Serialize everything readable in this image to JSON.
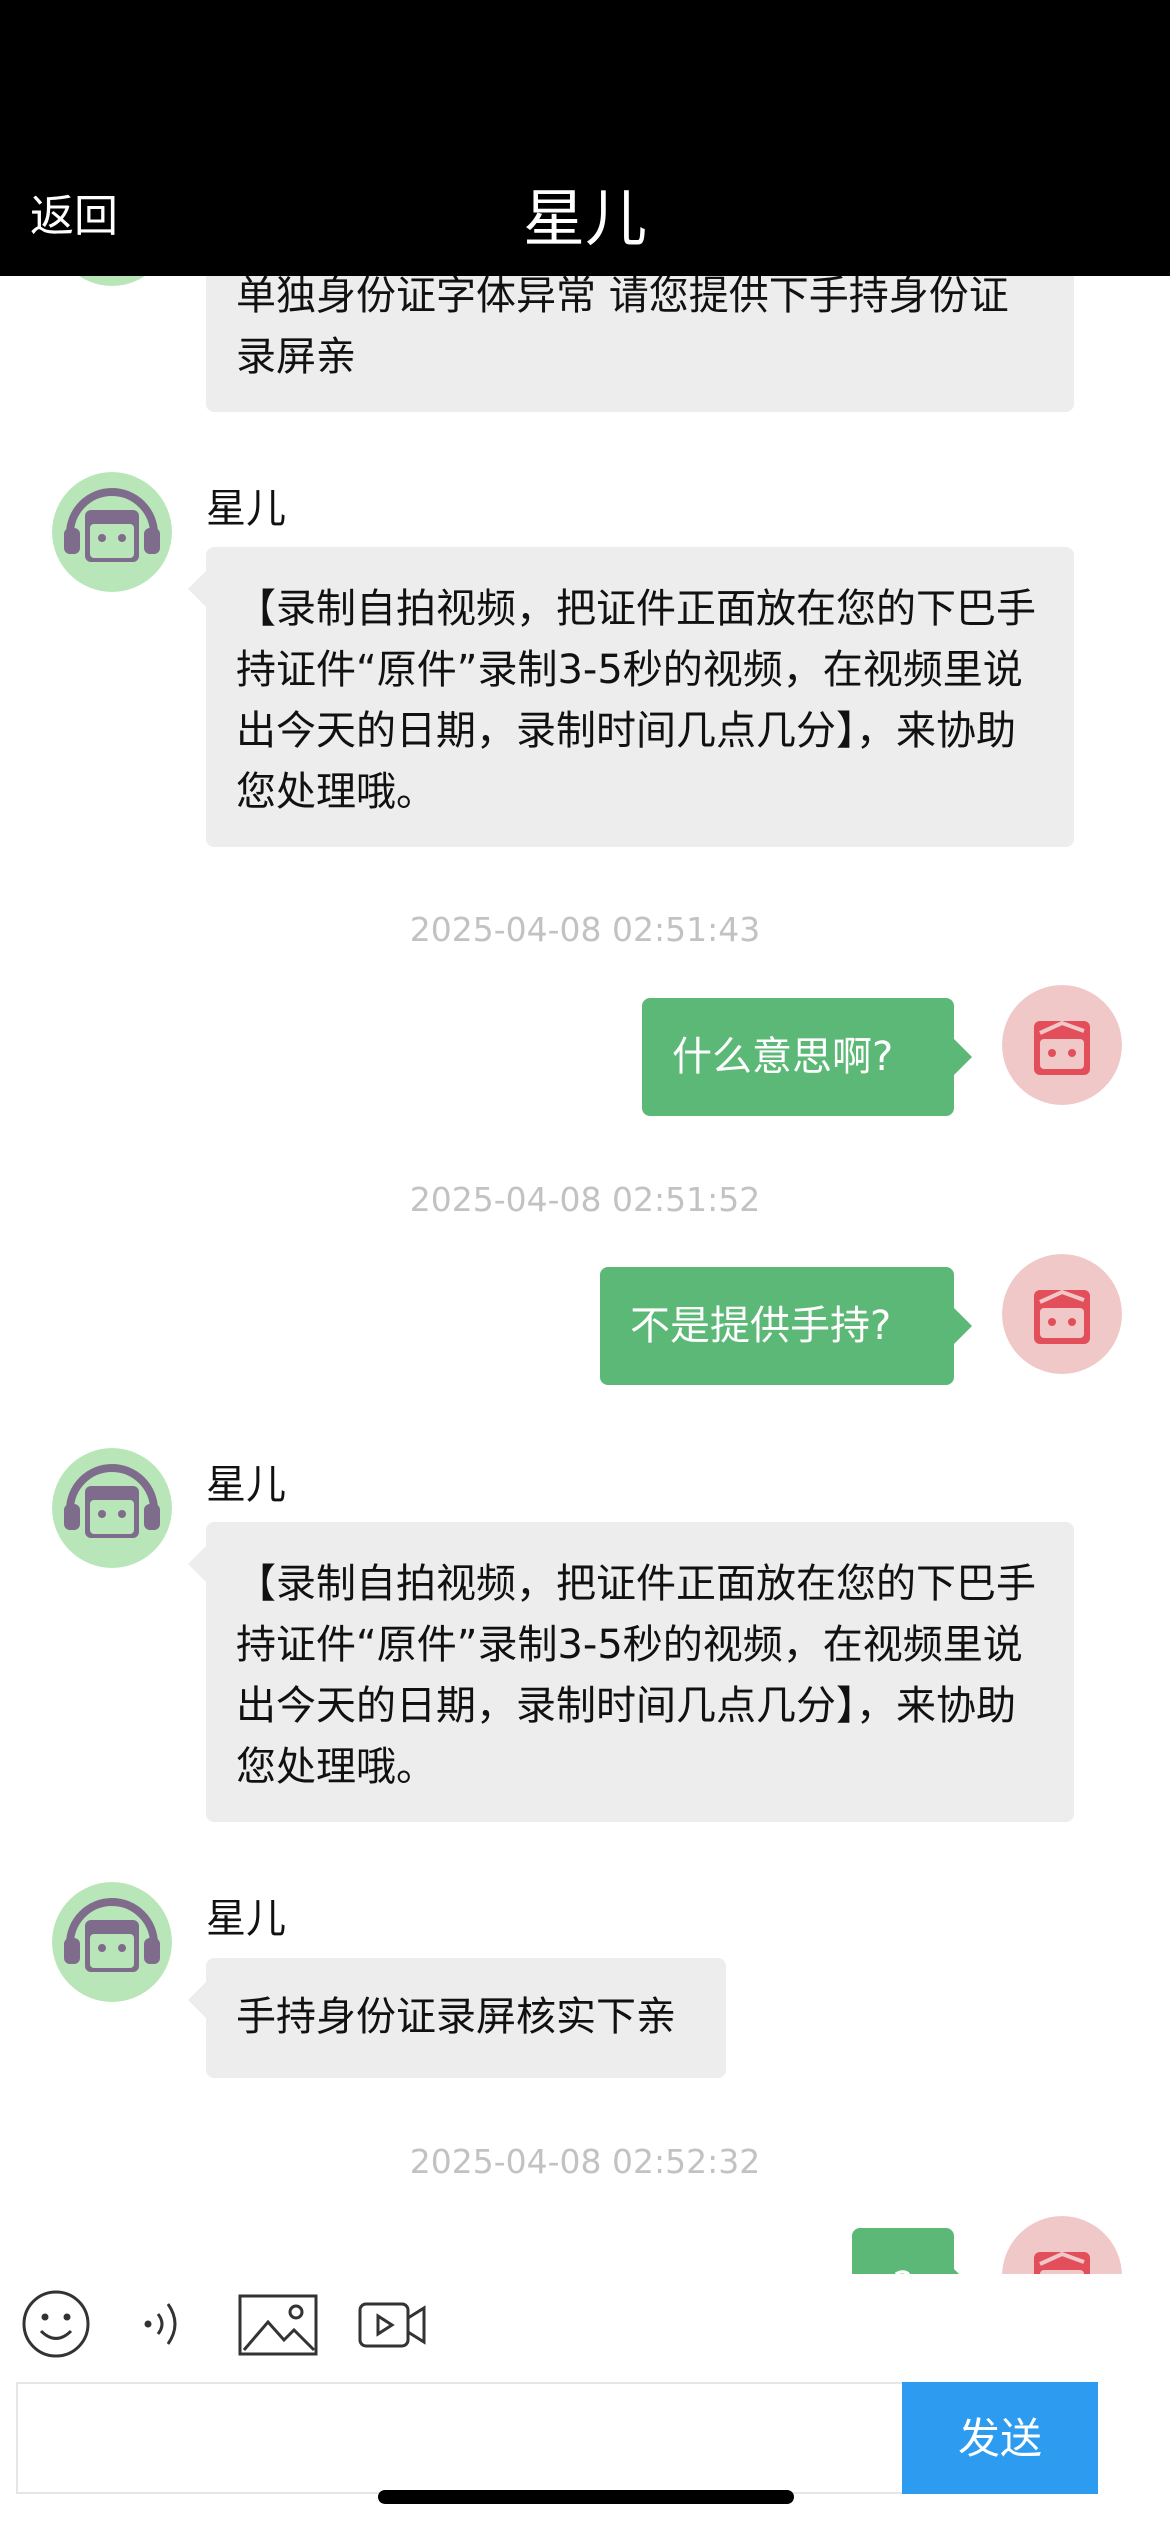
{
  "header": {
    "back_label": "返回",
    "title": "星儿"
  },
  "messages": {
    "m0": {
      "text": "单独身份证字体异常 请您提供下手持身份证录屏亲"
    },
    "m1": {
      "sender": "星儿",
      "text": "【录制自拍视频，把证件正面放在您的下巴手持证件“原件”录制3-5秒的视频，在视频里说出今天的日期，录制时间几点几分】，来协助您处理哦。"
    },
    "t1": "2025-04-08 02:51:43",
    "m2": {
      "text": "什么意思啊?"
    },
    "t2": "2025-04-08 02:51:52",
    "m3": {
      "text": "不是提供手持?"
    },
    "m4": {
      "sender": "星儿",
      "text": "【录制自拍视频，把证件正面放在您的下巴手持证件“原件”录制3-5秒的视频，在视频里说出今天的日期，录制时间几点几分】，来协助您处理哦。"
    },
    "m5": {
      "sender": "星儿",
      "text": "手持身份证录屏核实下亲"
    },
    "t3": "2025-04-08 02:52:32",
    "m6": {
      "text": "?"
    }
  },
  "input": {
    "placeholder": "",
    "send_label": "发送"
  },
  "icons": {
    "agent": "agent-avatar",
    "user": "user-avatar",
    "emoji": "emoji-icon",
    "voice": "voice-icon",
    "image": "image-icon",
    "video": "video-icon"
  },
  "colors": {
    "out_bubble": "#5cb876",
    "in_bubble": "#ededed",
    "send": "#2d9cf0"
  }
}
